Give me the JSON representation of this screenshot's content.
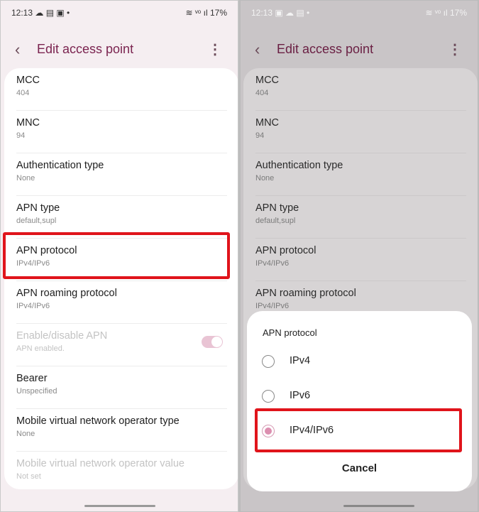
{
  "status": {
    "left": {
      "time": "12:13",
      "icons": "☁ ▤ ▣ •"
    },
    "right": {
      "time": "12:13",
      "icons": "▣ ☁ ▤ •"
    },
    "signal": "≋ ᵛᵒ ıl",
    "battery": "17%"
  },
  "appbar": {
    "title": "Edit access point",
    "back_icon": "‹",
    "more_icon": "⋮"
  },
  "settings": [
    {
      "title": "MCC",
      "value": "404"
    },
    {
      "title": "MNC",
      "value": "94"
    },
    {
      "title": "Authentication type",
      "value": "None"
    },
    {
      "title": "APN type",
      "value": "default,supl"
    },
    {
      "title": "APN protocol",
      "value": "IPv4/IPv6"
    },
    {
      "title": "APN roaming protocol",
      "value": "IPv4/IPv6"
    },
    {
      "title": "Enable/disable APN",
      "value": "APN enabled.",
      "disabled": true,
      "toggle": true
    },
    {
      "title": "Bearer",
      "value": "Unspecified"
    },
    {
      "title": "Mobile virtual network operator type",
      "value": "None"
    },
    {
      "title": "Mobile virtual network operator value",
      "value": "Not set",
      "disabled": true
    }
  ],
  "dialog": {
    "title": "APN protocol",
    "options": [
      {
        "label": "IPv4",
        "selected": false
      },
      {
        "label": "IPv6",
        "selected": false
      },
      {
        "label": "IPv4/IPv6",
        "selected": true
      }
    ],
    "cancel": "Cancel"
  },
  "colors": {
    "accent": "#7b2450",
    "highlight": "#e0141b",
    "radio": "#dc8fb0"
  }
}
